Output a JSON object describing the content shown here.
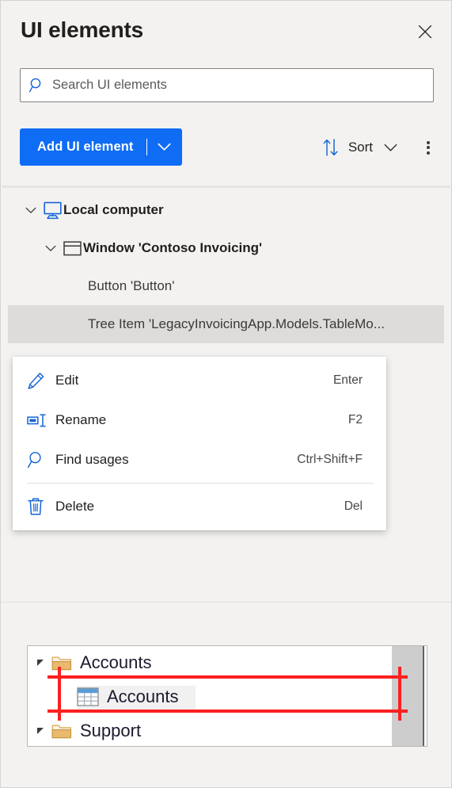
{
  "header": {
    "title": "UI elements",
    "close_icon": "close-icon"
  },
  "search": {
    "placeholder": "Search UI elements",
    "value": "",
    "icon": "search-icon"
  },
  "toolbar": {
    "add_label": "Add UI element",
    "add_caret_icon": "chevron-down-icon",
    "sort_label": "Sort",
    "sort_icon": "sort-arrows-icon",
    "sort_caret_icon": "chevron-down-icon",
    "more_icon": "more-vertical-icon",
    "accent_color": "#0f6cf5"
  },
  "tree": {
    "items": [
      {
        "label": "Local computer",
        "icon": "monitor-icon",
        "chevron": "chevron-down-icon",
        "level": 0,
        "selected": false
      },
      {
        "label": "Window 'Contoso Invoicing'",
        "icon": "window-icon",
        "chevron": "chevron-down-icon",
        "level": 1,
        "selected": false
      },
      {
        "label": "Button 'Button'",
        "icon": "",
        "chevron": "",
        "level": 2,
        "selected": false
      },
      {
        "label": "Tree Item 'LegacyInvoicingApp.Models.TableMo...",
        "icon": "",
        "chevron": "",
        "level": 3,
        "selected": true
      }
    ],
    "selected_background": "#dedcda"
  },
  "context_menu": {
    "items": [
      {
        "label": "Edit",
        "shortcut": "Enter",
        "icon": "pencil-icon",
        "separator_after": false
      },
      {
        "label": "Rename",
        "shortcut": "F2",
        "icon": "rename-icon",
        "separator_after": false
      },
      {
        "label": "Find usages",
        "shortcut": "Ctrl+Shift+F",
        "icon": "search-icon",
        "separator_after": true
      },
      {
        "label": "Delete",
        "shortcut": "Del",
        "icon": "trash-icon",
        "separator_after": false
      }
    ]
  },
  "preview": {
    "rows": [
      {
        "label": "Accounts",
        "icon": "folder-icon",
        "expander": "triangle-icon",
        "indent": 0,
        "highlighted": false
      },
      {
        "label": "Accounts",
        "icon": "table-icon",
        "expander": "",
        "indent": 1,
        "highlighted": true
      },
      {
        "label": "Support",
        "icon": "folder-icon",
        "expander": "triangle-icon",
        "indent": 0,
        "highlighted": false
      }
    ],
    "highlight_color": "#fc2020"
  }
}
